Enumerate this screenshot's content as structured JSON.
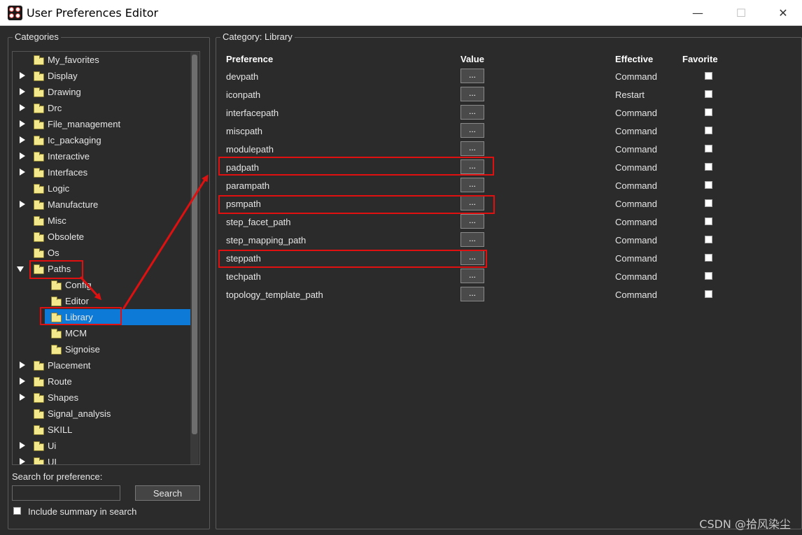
{
  "window": {
    "title": "User Preferences Editor",
    "minimize_glyph": "—",
    "maximize_glyph": "☐",
    "close_glyph": "✕"
  },
  "categories_panel": {
    "title": "Categories",
    "tree": [
      {
        "label": "My_favorites",
        "expander": "none",
        "level": 0
      },
      {
        "label": "Display",
        "expander": "collapsed",
        "level": 0
      },
      {
        "label": "Drawing",
        "expander": "collapsed",
        "level": 0
      },
      {
        "label": "Drc",
        "expander": "collapsed",
        "level": 0
      },
      {
        "label": "File_management",
        "expander": "collapsed",
        "level": 0
      },
      {
        "label": "Ic_packaging",
        "expander": "collapsed",
        "level": 0
      },
      {
        "label": "Interactive",
        "expander": "collapsed",
        "level": 0
      },
      {
        "label": "Interfaces",
        "expander": "collapsed",
        "level": 0
      },
      {
        "label": "Logic",
        "expander": "none",
        "level": 0
      },
      {
        "label": "Manufacture",
        "expander": "collapsed",
        "level": 0
      },
      {
        "label": "Misc",
        "expander": "none",
        "level": 0
      },
      {
        "label": "Obsolete",
        "expander": "none",
        "level": 0
      },
      {
        "label": "Os",
        "expander": "none",
        "level": 0
      },
      {
        "label": "Paths",
        "expander": "expanded",
        "level": 0
      },
      {
        "label": "Config",
        "expander": "none",
        "level": 1
      },
      {
        "label": "Editor",
        "expander": "none",
        "level": 1
      },
      {
        "label": "Library",
        "expander": "none",
        "level": 1,
        "selected": true
      },
      {
        "label": "MCM",
        "expander": "none",
        "level": 1
      },
      {
        "label": "Signoise",
        "expander": "none",
        "level": 1
      },
      {
        "label": "Placement",
        "expander": "collapsed",
        "level": 0
      },
      {
        "label": "Route",
        "expander": "collapsed",
        "level": 0
      },
      {
        "label": "Shapes",
        "expander": "collapsed",
        "level": 0
      },
      {
        "label": "Signal_analysis",
        "expander": "none",
        "level": 0
      },
      {
        "label": "SKILL",
        "expander": "none",
        "level": 0
      },
      {
        "label": "Ui",
        "expander": "collapsed",
        "level": 0
      },
      {
        "label": "UI",
        "expander": "collapsed",
        "level": 0
      }
    ],
    "search_label": "Search for preference:",
    "search_value": "",
    "search_button": "Search",
    "include_summary_label": "Include summary in search",
    "include_summary_checked": false
  },
  "preferences_panel": {
    "title": "Category:  Library",
    "headers": {
      "preference": "Preference",
      "value": "Value",
      "effective": "Effective",
      "favorite": "Favorite"
    },
    "value_button_label": "...",
    "rows": [
      {
        "name": "devpath",
        "effective": "Command",
        "favorite": false
      },
      {
        "name": "iconpath",
        "effective": "Restart",
        "favorite": false
      },
      {
        "name": "interfacepath",
        "effective": "Command",
        "favorite": false
      },
      {
        "name": "miscpath",
        "effective": "Command",
        "favorite": false
      },
      {
        "name": "modulepath",
        "effective": "Command",
        "favorite": false
      },
      {
        "name": "padpath",
        "effective": "Command",
        "favorite": false
      },
      {
        "name": "parampath",
        "effective": "Command",
        "favorite": false
      },
      {
        "name": "psmpath",
        "effective": "Command",
        "favorite": false
      },
      {
        "name": "step_facet_path",
        "effective": "Command",
        "favorite": false
      },
      {
        "name": "step_mapping_path",
        "effective": "Command",
        "favorite": false
      },
      {
        "name": "steppath",
        "effective": "Command",
        "favorite": false
      },
      {
        "name": "techpath",
        "effective": "Command",
        "favorite": false
      },
      {
        "name": "topology_template_path",
        "effective": "Command",
        "favorite": false
      }
    ]
  },
  "watermark": "CSDN @拾风染尘",
  "colors": {
    "background": "#2b2b2b",
    "selection": "#0e7ad7",
    "annotation": "#e01010",
    "folder": "#f3e98c"
  }
}
